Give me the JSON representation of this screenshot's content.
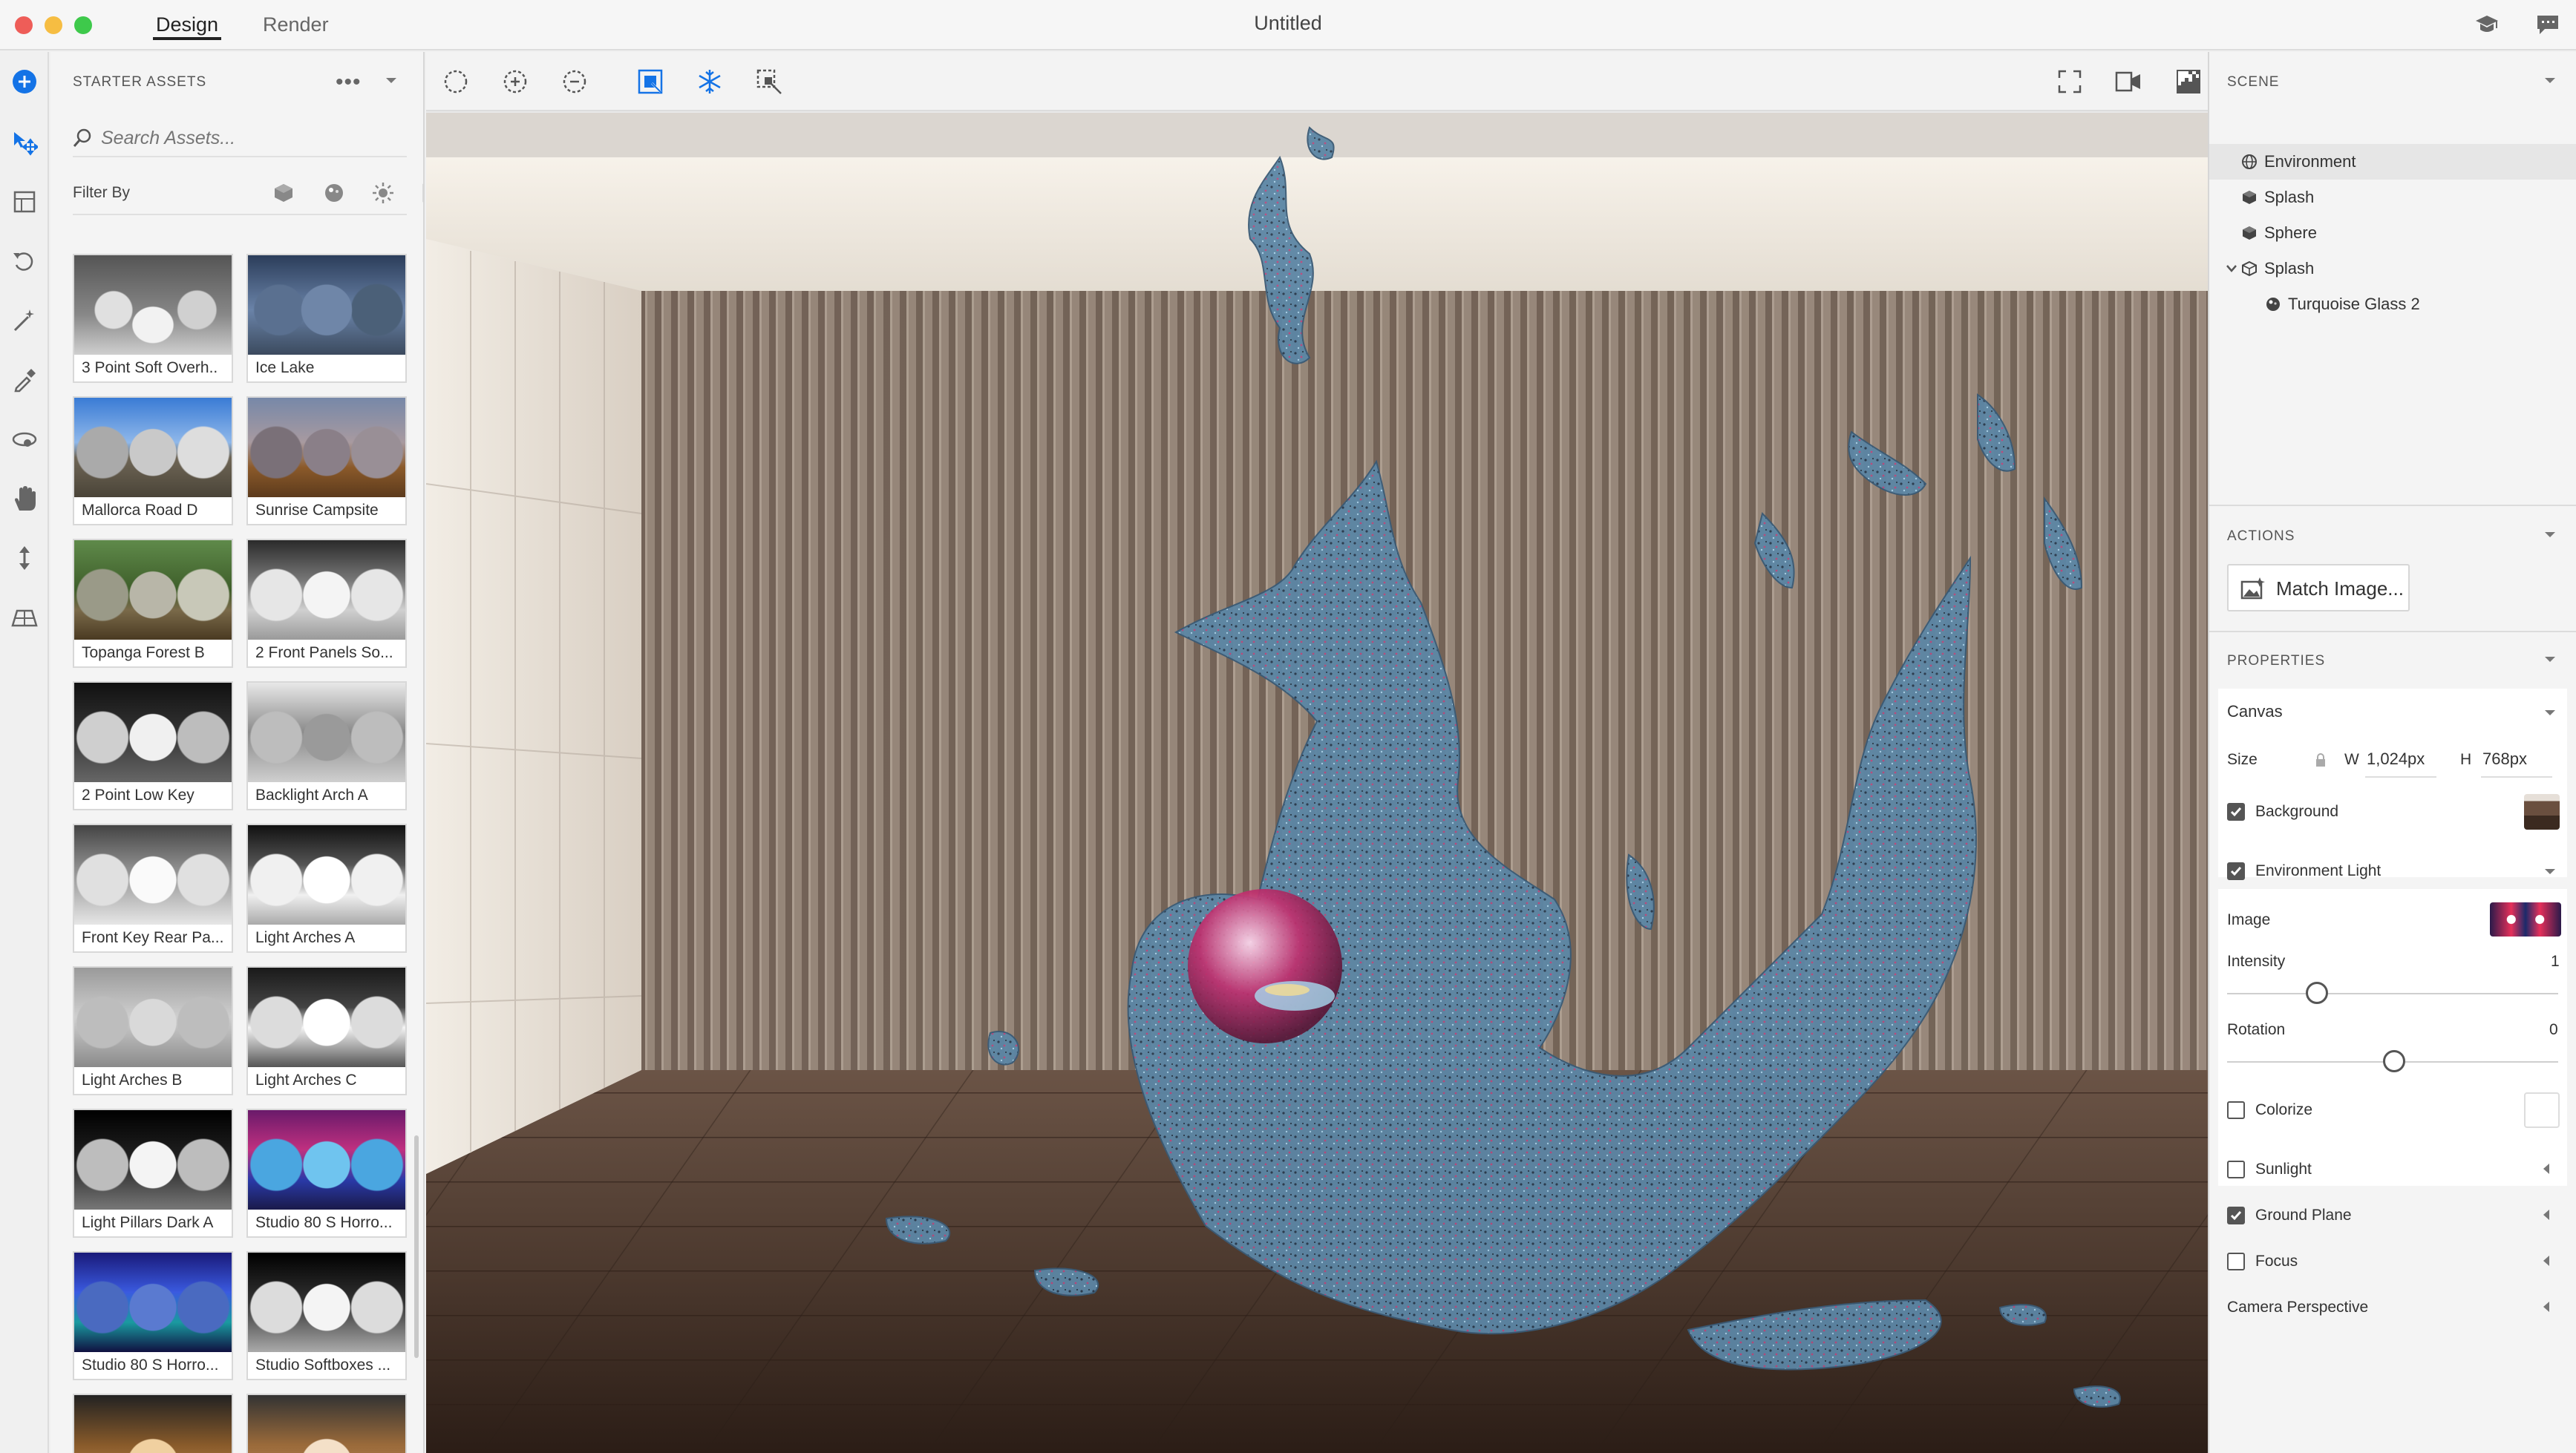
{
  "titlebar": {
    "tabs": [
      "Design",
      "Render"
    ],
    "active_tab": "Design",
    "document_title": "Untitled",
    "colors": {
      "close": "#ee5d58",
      "minimize": "#f6bd42",
      "maximize": "#3ec94b"
    }
  },
  "left_tools": [
    {
      "icon": "add-icon"
    },
    {
      "icon": "move-select-icon"
    },
    {
      "icon": "frame-icon"
    },
    {
      "icon": "rotate-icon"
    },
    {
      "icon": "magic-wand-icon"
    },
    {
      "icon": "eyedropper-icon"
    },
    {
      "icon": "orbit-icon"
    },
    {
      "icon": "hand-pan-icon"
    },
    {
      "icon": "dolly-icon"
    },
    {
      "icon": "ground-plane-icon"
    }
  ],
  "assets_panel": {
    "title": "STARTER ASSETS",
    "more": "•••",
    "search_placeholder": "Search Assets...",
    "filter_label": "Filter By",
    "filter_icons": [
      "model-filter-icon",
      "material-filter-icon",
      "light-filter-icon",
      "image-filter-icon"
    ],
    "items": [
      {
        "label": "3 Point Soft Overh..",
        "style": "studio-white"
      },
      {
        "label": "Ice Lake",
        "style": "ice-lake"
      },
      {
        "label": "Mallorca Road D",
        "style": "mallorca"
      },
      {
        "label": "Sunrise Campsite",
        "style": "campsite"
      },
      {
        "label": "Topanga Forest B",
        "style": "forest"
      },
      {
        "label": "2 Front Panels So...",
        "style": "panels"
      },
      {
        "label": "2 Point Low Key",
        "style": "lowkey"
      },
      {
        "label": "Backlight Arch A",
        "style": "arch"
      },
      {
        "label": "Front Key Rear Pa...",
        "style": "frontkey"
      },
      {
        "label": "Light Arches A",
        "style": "arches"
      },
      {
        "label": "Light Arches B",
        "style": "archesb"
      },
      {
        "label": "Light Arches C",
        "style": "archesc"
      },
      {
        "label": "Light Pillars Dark A",
        "style": "pillars"
      },
      {
        "label": "Studio 80 S Horro...",
        "style": "horror1"
      },
      {
        "label": "Studio 80 S Horro...",
        "style": "horror2"
      },
      {
        "label": "Studio Softboxes ...",
        "style": "softboxes"
      },
      {
        "label": "",
        "style": "warm1"
      },
      {
        "label": "",
        "style": "warm2"
      }
    ]
  },
  "viewport": {
    "tools": [
      "lasso-select-icon",
      "add-select-icon",
      "subtract-select-icon",
      "fit-selection-icon",
      "snowflake-icon",
      "transform-select-icon"
    ],
    "right_tools": [
      "fullscreen-icon",
      "camera-bookmark-icon",
      "render-preview-icon"
    ]
  },
  "scene": {
    "title": "SCENE",
    "items": [
      {
        "label": "Environment",
        "icon": "environment-icon",
        "indent": 0,
        "selected": true
      },
      {
        "label": "Splash",
        "icon": "model-icon",
        "indent": 0,
        "selected": false
      },
      {
        "label": "Sphere",
        "icon": "model-icon",
        "indent": 0,
        "selected": false
      },
      {
        "label": "Splash",
        "icon": "group-icon",
        "indent": 0,
        "selected": false,
        "expanded": true
      },
      {
        "label": "Turquoise Glass 2",
        "icon": "material-icon",
        "indent": 1,
        "selected": false
      }
    ]
  },
  "actions": {
    "title": "ACTIONS",
    "match_image": "Match Image..."
  },
  "properties": {
    "title": "PROPERTIES",
    "canvas": "Canvas",
    "size_label": "Size",
    "w_label": "W",
    "w_value": "1,024px",
    "h_label": "H",
    "h_value": "768px",
    "background": {
      "label": "Background",
      "checked": true
    },
    "environment_light": {
      "label": "Environment Light",
      "checked": true
    },
    "image_label": "Image",
    "intensity": {
      "label": "Intensity",
      "value": "1",
      "fraction": 0.25
    },
    "rotation": {
      "label": "Rotation",
      "value": "0",
      "fraction": 0.5
    },
    "colorize": {
      "label": "Colorize",
      "checked": false
    },
    "sunlight": {
      "label": "Sunlight",
      "checked": false
    },
    "ground_plane": {
      "label": "Ground Plane",
      "checked": true
    },
    "focus": {
      "label": "Focus",
      "checked": false
    },
    "camera_perspective": "Camera Perspective"
  }
}
